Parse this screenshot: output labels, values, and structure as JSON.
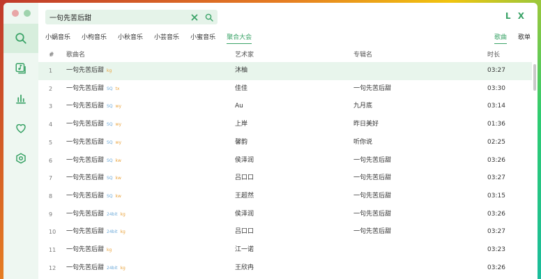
{
  "search": {
    "value": "一句先苦后甜"
  },
  "logo": "L X",
  "sources": [
    "小蜗音乐",
    "小枸音乐",
    "小秋音乐",
    "小芸音乐",
    "小蜜音乐",
    "聚合大会"
  ],
  "active_source": "聚合大会",
  "types": [
    "歌曲",
    "歌单"
  ],
  "active_type": "歌曲",
  "columns": {
    "num": "#",
    "name": "歌曲名",
    "artist": "艺术家",
    "album": "专辑名",
    "duration": "时长"
  },
  "colors": {
    "accent": "#3aa367",
    "sidebar_bg": "#eef7f1",
    "active_row": "#e8f5ec",
    "sq_tag": "#6aa8d8",
    "quality_tag": "#e9a23b"
  },
  "sidebar_icons": [
    "search-icon",
    "music-library-icon",
    "chart-icon",
    "heart-icon",
    "settings-icon"
  ],
  "rows": [
    {
      "num": "1",
      "name": "一句先苦后甜",
      "tags": [
        "",
        "kg"
      ],
      "artist": "沐柚",
      "album": "",
      "duration": "03:27"
    },
    {
      "num": "2",
      "name": "一句先苦后甜",
      "tags": [
        "SQ",
        "tx"
      ],
      "artist": "佳佳",
      "album": "一句先苦后甜",
      "duration": "03:30"
    },
    {
      "num": "3",
      "name": "一句先苦后甜",
      "tags": [
        "SQ",
        "wy"
      ],
      "artist": "Au",
      "album": "九月底",
      "duration": "03:14"
    },
    {
      "num": "4",
      "name": "一句先苦后甜",
      "tags": [
        "SQ",
        "wy"
      ],
      "artist": "上岸",
      "album": "昨日美好",
      "duration": "01:36"
    },
    {
      "num": "5",
      "name": "一句先苦后甜",
      "tags": [
        "SQ",
        "wy"
      ],
      "artist": "馨韵",
      "album": "听你说",
      "duration": "02:25"
    },
    {
      "num": "6",
      "name": "一句先苦后甜",
      "tags": [
        "SQ",
        "kw"
      ],
      "artist": "侯泽润",
      "album": "一句先苦后甜",
      "duration": "03:26"
    },
    {
      "num": "7",
      "name": "一句先苦后甜",
      "tags": [
        "SQ",
        "kw"
      ],
      "artist": "吕口口",
      "album": "一句先苦后甜",
      "duration": "03:27"
    },
    {
      "num": "8",
      "name": "一句先苦后甜",
      "tags": [
        "SQ",
        "kw"
      ],
      "artist": "王超然",
      "album": "一句先苦后甜",
      "duration": "03:15"
    },
    {
      "num": "9",
      "name": "一句先苦后甜",
      "tags": [
        "24bit",
        "kg"
      ],
      "artist": "侯泽润",
      "album": "一句先苦后甜",
      "duration": "03:26"
    },
    {
      "num": "10",
      "name": "一句先苦后甜",
      "tags": [
        "24bit",
        "kg"
      ],
      "artist": "吕口口",
      "album": "一句先苦后甜",
      "duration": "03:27"
    },
    {
      "num": "11",
      "name": "一句先苦后甜",
      "tags": [
        "",
        "kg"
      ],
      "artist": "江一诺",
      "album": "",
      "duration": "03:23"
    },
    {
      "num": "12",
      "name": "一句先苦后甜",
      "tags": [
        "24bit",
        "kg"
      ],
      "artist": "王欣冉",
      "album": "",
      "duration": "03:26"
    }
  ]
}
